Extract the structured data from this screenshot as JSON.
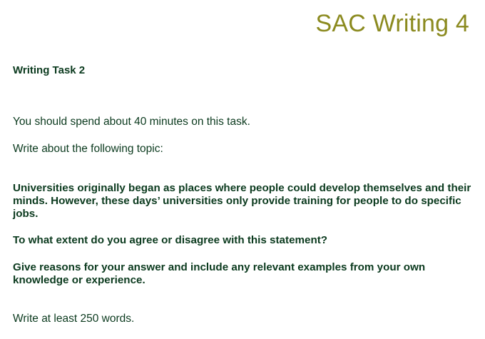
{
  "header": {
    "title": "SAC Writing 4"
  },
  "task": {
    "heading": "Writing Task 2",
    "time_note": "You should spend about 40 minutes on this task.",
    "topic_intro": "Write about the following topic:",
    "statement": "Universities originally began as places where people could develop themselves and their minds. However, these days’ universities only provide training for people to do specific jobs.",
    "question": "To what extent do you agree or disagree with this statement?",
    "instructions": "Give reasons for your answer and include any relevant examples from your own knowledge or experience.",
    "word_count": "Write at least 250 words."
  },
  "colors": {
    "title": "#8b8a1f",
    "text": "#0b3a1e"
  }
}
